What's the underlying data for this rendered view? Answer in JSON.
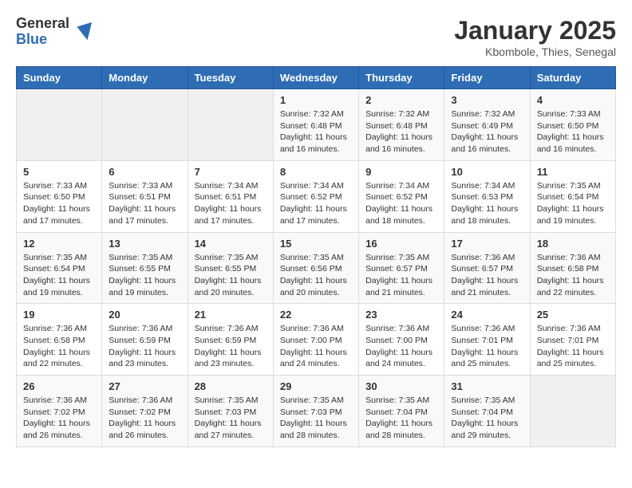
{
  "header": {
    "logo_general": "General",
    "logo_blue": "Blue",
    "month_title": "January 2025",
    "location": "Kbombole, Thies, Senegal"
  },
  "days_of_week": [
    "Sunday",
    "Monday",
    "Tuesday",
    "Wednesday",
    "Thursday",
    "Friday",
    "Saturday"
  ],
  "weeks": [
    [
      {
        "day": "",
        "info": ""
      },
      {
        "day": "",
        "info": ""
      },
      {
        "day": "",
        "info": ""
      },
      {
        "day": "1",
        "info": "Sunrise: 7:32 AM\nSunset: 6:48 PM\nDaylight: 11 hours and 16 minutes."
      },
      {
        "day": "2",
        "info": "Sunrise: 7:32 AM\nSunset: 6:48 PM\nDaylight: 11 hours and 16 minutes."
      },
      {
        "day": "3",
        "info": "Sunrise: 7:32 AM\nSunset: 6:49 PM\nDaylight: 11 hours and 16 minutes."
      },
      {
        "day": "4",
        "info": "Sunrise: 7:33 AM\nSunset: 6:50 PM\nDaylight: 11 hours and 16 minutes."
      }
    ],
    [
      {
        "day": "5",
        "info": "Sunrise: 7:33 AM\nSunset: 6:50 PM\nDaylight: 11 hours and 17 minutes."
      },
      {
        "day": "6",
        "info": "Sunrise: 7:33 AM\nSunset: 6:51 PM\nDaylight: 11 hours and 17 minutes."
      },
      {
        "day": "7",
        "info": "Sunrise: 7:34 AM\nSunset: 6:51 PM\nDaylight: 11 hours and 17 minutes."
      },
      {
        "day": "8",
        "info": "Sunrise: 7:34 AM\nSunset: 6:52 PM\nDaylight: 11 hours and 17 minutes."
      },
      {
        "day": "9",
        "info": "Sunrise: 7:34 AM\nSunset: 6:52 PM\nDaylight: 11 hours and 18 minutes."
      },
      {
        "day": "10",
        "info": "Sunrise: 7:34 AM\nSunset: 6:53 PM\nDaylight: 11 hours and 18 minutes."
      },
      {
        "day": "11",
        "info": "Sunrise: 7:35 AM\nSunset: 6:54 PM\nDaylight: 11 hours and 19 minutes."
      }
    ],
    [
      {
        "day": "12",
        "info": "Sunrise: 7:35 AM\nSunset: 6:54 PM\nDaylight: 11 hours and 19 minutes."
      },
      {
        "day": "13",
        "info": "Sunrise: 7:35 AM\nSunset: 6:55 PM\nDaylight: 11 hours and 19 minutes."
      },
      {
        "day": "14",
        "info": "Sunrise: 7:35 AM\nSunset: 6:55 PM\nDaylight: 11 hours and 20 minutes."
      },
      {
        "day": "15",
        "info": "Sunrise: 7:35 AM\nSunset: 6:56 PM\nDaylight: 11 hours and 20 minutes."
      },
      {
        "day": "16",
        "info": "Sunrise: 7:35 AM\nSunset: 6:57 PM\nDaylight: 11 hours and 21 minutes."
      },
      {
        "day": "17",
        "info": "Sunrise: 7:36 AM\nSunset: 6:57 PM\nDaylight: 11 hours and 21 minutes."
      },
      {
        "day": "18",
        "info": "Sunrise: 7:36 AM\nSunset: 6:58 PM\nDaylight: 11 hours and 22 minutes."
      }
    ],
    [
      {
        "day": "19",
        "info": "Sunrise: 7:36 AM\nSunset: 6:58 PM\nDaylight: 11 hours and 22 minutes."
      },
      {
        "day": "20",
        "info": "Sunrise: 7:36 AM\nSunset: 6:59 PM\nDaylight: 11 hours and 23 minutes."
      },
      {
        "day": "21",
        "info": "Sunrise: 7:36 AM\nSunset: 6:59 PM\nDaylight: 11 hours and 23 minutes."
      },
      {
        "day": "22",
        "info": "Sunrise: 7:36 AM\nSunset: 7:00 PM\nDaylight: 11 hours and 24 minutes."
      },
      {
        "day": "23",
        "info": "Sunrise: 7:36 AM\nSunset: 7:00 PM\nDaylight: 11 hours and 24 minutes."
      },
      {
        "day": "24",
        "info": "Sunrise: 7:36 AM\nSunset: 7:01 PM\nDaylight: 11 hours and 25 minutes."
      },
      {
        "day": "25",
        "info": "Sunrise: 7:36 AM\nSunset: 7:01 PM\nDaylight: 11 hours and 25 minutes."
      }
    ],
    [
      {
        "day": "26",
        "info": "Sunrise: 7:36 AM\nSunset: 7:02 PM\nDaylight: 11 hours and 26 minutes."
      },
      {
        "day": "27",
        "info": "Sunrise: 7:36 AM\nSunset: 7:02 PM\nDaylight: 11 hours and 26 minutes."
      },
      {
        "day": "28",
        "info": "Sunrise: 7:35 AM\nSunset: 7:03 PM\nDaylight: 11 hours and 27 minutes."
      },
      {
        "day": "29",
        "info": "Sunrise: 7:35 AM\nSunset: 7:03 PM\nDaylight: 11 hours and 28 minutes."
      },
      {
        "day": "30",
        "info": "Sunrise: 7:35 AM\nSunset: 7:04 PM\nDaylight: 11 hours and 28 minutes."
      },
      {
        "day": "31",
        "info": "Sunrise: 7:35 AM\nSunset: 7:04 PM\nDaylight: 11 hours and 29 minutes."
      },
      {
        "day": "",
        "info": ""
      }
    ]
  ]
}
